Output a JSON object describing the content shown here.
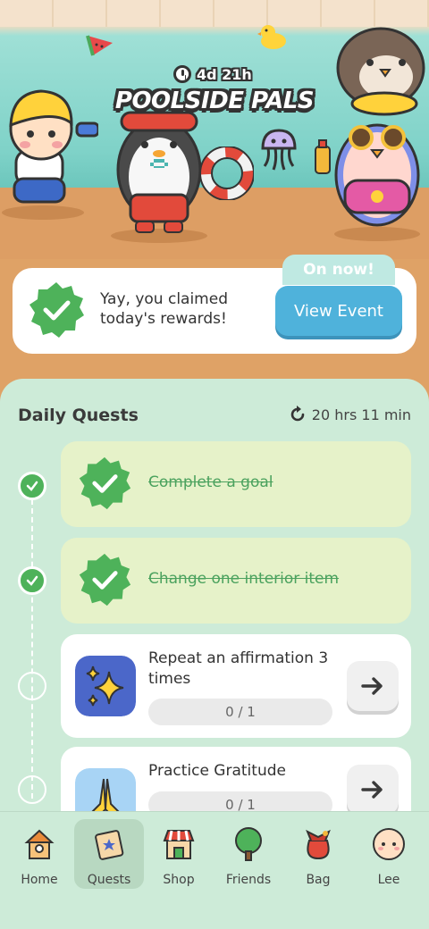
{
  "event": {
    "time_left": "4d 21h",
    "title": "POOLSIDE PALS",
    "on_now_label": "On now!",
    "view_event_label": "View Event"
  },
  "claimed": {
    "message": "Yay, you claimed today's rewards!"
  },
  "daily_quests": {
    "title": "Daily Quests",
    "reset_timer": "20 hrs 11 min",
    "items": [
      {
        "title": "Complete a goal",
        "status": "completed"
      },
      {
        "title": "Change one interior item",
        "status": "completed"
      },
      {
        "title": "Repeat an affirmation 3 times",
        "progress": "0 / 1",
        "status": "open",
        "icon": "sparkles-icon"
      },
      {
        "title": "Practice Gratitude",
        "progress": "0 / 1",
        "status": "open",
        "icon": "praying-hands-icon"
      }
    ]
  },
  "nav": {
    "items": [
      {
        "label": "Home",
        "icon": "house-icon"
      },
      {
        "label": "Quests",
        "icon": "quests-icon",
        "active": true
      },
      {
        "label": "Shop",
        "icon": "shop-icon"
      },
      {
        "label": "Friends",
        "icon": "tree-icon"
      },
      {
        "label": "Bag",
        "icon": "bag-icon"
      },
      {
        "label": "Lee",
        "icon": "avatar-icon"
      }
    ]
  },
  "colors": {
    "accent_green": "#4eb25a",
    "view_event_blue": "#4fb2db",
    "panel_mint": "#cdebd8",
    "done_card": "#e6f2c9"
  }
}
